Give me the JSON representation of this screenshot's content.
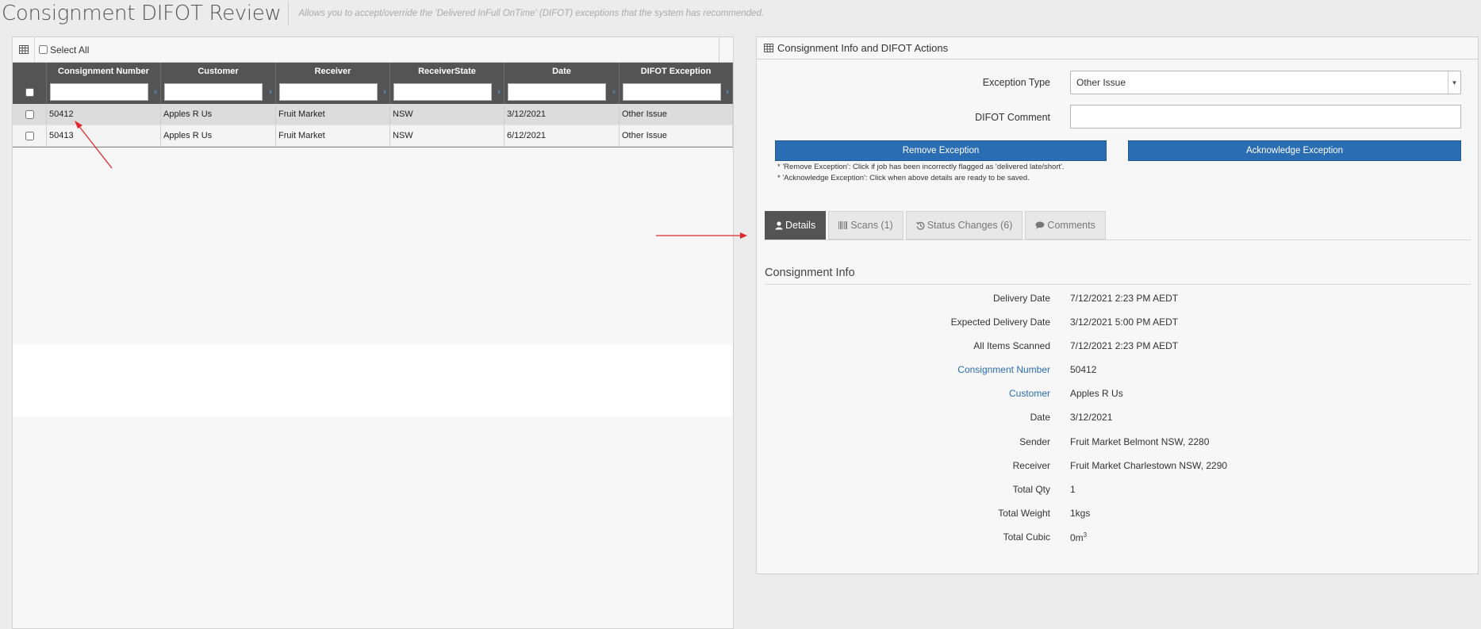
{
  "header": {
    "title": "Consignment DIFOT Review",
    "subtitle": "Allows you to accept/override the 'Delivered InFull OnTime' (DIFOT) exceptions that the system has recommended."
  },
  "left_panel": {
    "select_all_label": "Select All",
    "columns": [
      "Consignment Number",
      "Customer",
      "Receiver",
      "ReceiverState",
      "Date",
      "DIFOT Exception"
    ],
    "filter_clear": "x",
    "rows": [
      {
        "number": "50412",
        "customer": "Apples R Us",
        "receiver": "Fruit Market",
        "state": "NSW",
        "date": "3/12/2021",
        "exception": "Other Issue"
      },
      {
        "number": "50413",
        "customer": "Apples R Us",
        "receiver": "Fruit Market",
        "state": "NSW",
        "date": "6/12/2021",
        "exception": "Other Issue"
      }
    ]
  },
  "right_panel": {
    "title": "Consignment Info and DIFOT Actions",
    "exception_type_label": "Exception Type",
    "exception_type_value": "Other Issue",
    "difot_comment_label": "DIFOT Comment",
    "difot_comment_value": "",
    "remove_button": "Remove Exception",
    "acknowledge_button": "Acknowledge Exception",
    "help_remove": "* 'Remove Exception': Click if job has been incorrectly flagged as 'delivered late/short'.",
    "help_acknowledge": "* 'Acknowledge Exception': Click when above details are ready to be saved.",
    "tabs": {
      "details": "Details",
      "scans": "Scans (1)",
      "status_changes": "Status Changes (6)",
      "comments": "Comments"
    },
    "section_title": "Consignment Info",
    "details": {
      "delivery_date": {
        "label": "Delivery Date",
        "value": "7/12/2021 2:23 PM AEDT"
      },
      "expected_delivery_date": {
        "label": "Expected Delivery Date",
        "value": "3/12/2021 5:00 PM AEDT"
      },
      "all_items_scanned": {
        "label": "All Items Scanned",
        "value": "7/12/2021 2:23 PM AEDT"
      },
      "consignment_number": {
        "label": "Consignment Number",
        "value": "50412"
      },
      "customer": {
        "label": "Customer",
        "value": "Apples R Us"
      },
      "date": {
        "label": "Date",
        "value": "3/12/2021"
      },
      "sender": {
        "label": "Sender",
        "value": "Fruit Market Belmont NSW, 2280"
      },
      "receiver": {
        "label": "Receiver",
        "value": "Fruit Market Charlestown NSW, 2290"
      },
      "total_qty": {
        "label": "Total Qty",
        "value": "1"
      },
      "total_weight": {
        "label": "Total Weight",
        "value": "1kgs"
      },
      "total_cubic": {
        "label": "Total Cubic",
        "value": "0m",
        "unit_sup": "3"
      }
    }
  },
  "colors": {
    "grid_header": "#545454",
    "button_blue": "#2a6db3",
    "link_blue": "#2a6db3",
    "annotation_red": "#e0282e"
  },
  "icons": {
    "grid": "table-icon",
    "details": "user-icon",
    "scans": "barcode-icon",
    "status_changes": "history-icon",
    "comments": "comment-icon"
  }
}
